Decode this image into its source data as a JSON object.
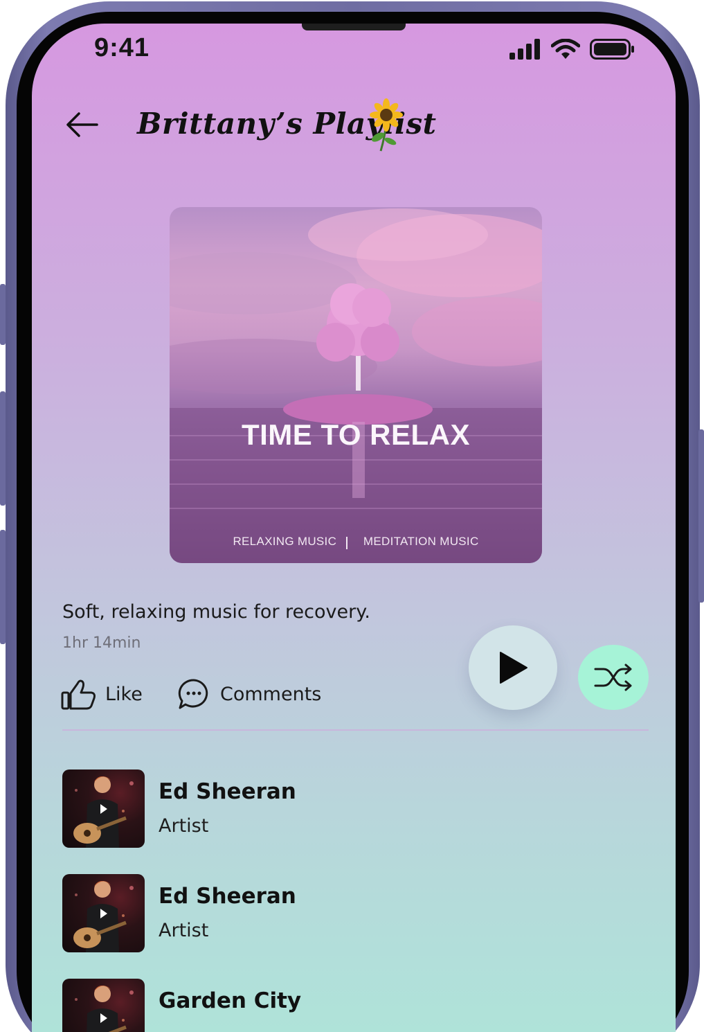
{
  "status_bar": {
    "time": "9:41"
  },
  "header": {
    "title": "Brittany’s Playlist"
  },
  "cover": {
    "title": "TIME TO RELAX",
    "tag_left": "RELAXING MUSIC",
    "separator": "|",
    "tag_right": "MEDITATION MUSIC"
  },
  "playlist": {
    "description": "Soft, relaxing music for recovery.",
    "duration": "1hr 14min"
  },
  "actions": {
    "like_label": "Like",
    "comments_label": "Comments"
  },
  "colors": {
    "play_bg": "#d2e4e8",
    "shuffle_bg": "#a6f3d7",
    "gradient_top": "#d698e0",
    "gradient_bottom": "#afe3d9"
  },
  "tracks": [
    {
      "name": "Ed Sheeran",
      "subtitle": "Artist"
    },
    {
      "name": "Ed Sheeran",
      "subtitle": "Artist"
    },
    {
      "name": "Garden City",
      "subtitle": ""
    }
  ]
}
